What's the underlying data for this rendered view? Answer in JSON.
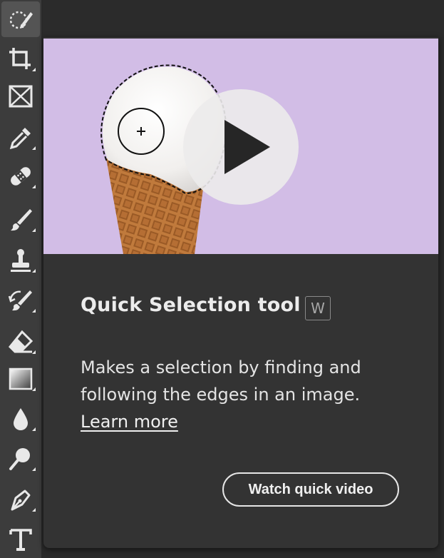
{
  "toolbar": {
    "tools": [
      {
        "icon": "quick-selection-icon",
        "active": true
      },
      {
        "icon": "crop-icon",
        "active": false
      },
      {
        "icon": "frame-icon",
        "active": false
      },
      {
        "icon": "eyedropper-icon",
        "active": false
      },
      {
        "icon": "healing-brush-icon",
        "active": false
      },
      {
        "icon": "brush-icon",
        "active": false
      },
      {
        "icon": "clone-stamp-icon",
        "active": false
      },
      {
        "icon": "history-brush-icon",
        "active": false
      },
      {
        "icon": "eraser-icon",
        "active": false
      },
      {
        "icon": "gradient-icon",
        "active": false
      },
      {
        "icon": "blur-icon",
        "active": false
      },
      {
        "icon": "dodge-icon",
        "active": false
      },
      {
        "icon": "pen-icon",
        "active": false
      },
      {
        "icon": "type-icon",
        "active": false
      }
    ]
  },
  "popup": {
    "preview_background": "#d2bde6",
    "play_icon": "play-icon",
    "title": "Quick Selection tool",
    "shortcut": "W",
    "description": "Makes a selection by finding and following the edges in an image.",
    "learn_more": "Learn more",
    "watch_button": "Watch quick video"
  }
}
